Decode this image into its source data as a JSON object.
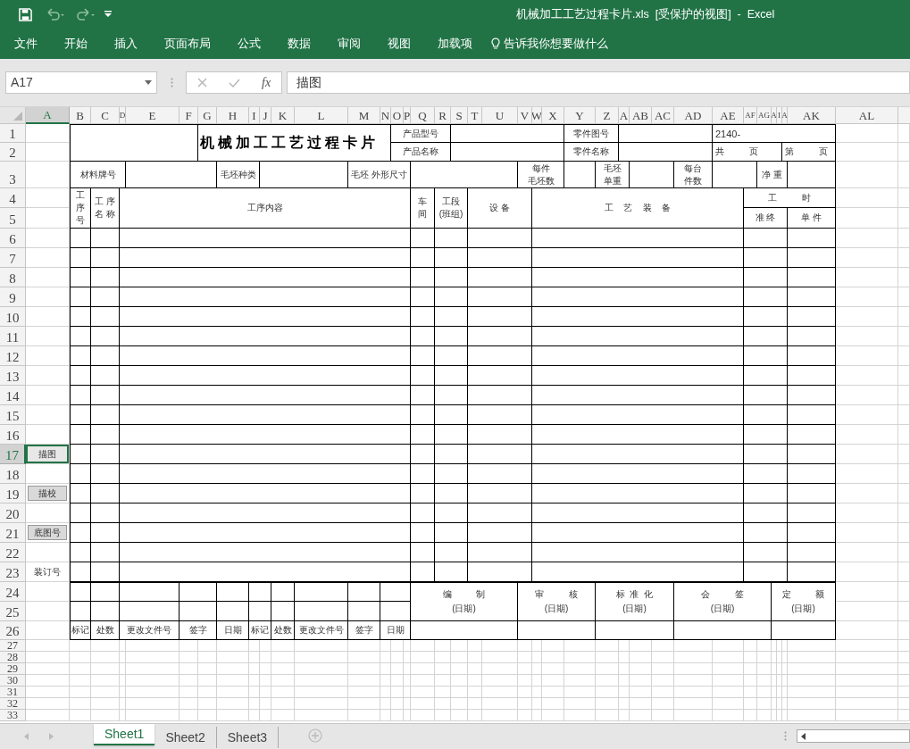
{
  "window": {
    "title": "机械加工工艺过程卡片.xls  [受保护的视图]  -  Excel"
  },
  "ribbon_tabs": [
    "文件",
    "开始",
    "插入",
    "页面布局",
    "公式",
    "数据",
    "审阅",
    "视图",
    "加载项"
  ],
  "tell_me": "告诉我你想要做什么",
  "name_box": "A17",
  "fx_label": "fx",
  "formula": "描图",
  "columns": [
    {
      "label": "A",
      "selected": true
    },
    {
      "label": "B",
      "selected": false
    },
    {
      "label": "C",
      "selected": false
    },
    {
      "label": "D",
      "selected": false
    },
    {
      "label": "E",
      "selected": false
    },
    {
      "label": "F",
      "selected": false
    },
    {
      "label": "G",
      "selected": false
    },
    {
      "label": "H",
      "selected": false
    },
    {
      "label": "I",
      "selected": false
    },
    {
      "label": "J",
      "selected": false
    },
    {
      "label": "K",
      "selected": false
    },
    {
      "label": "L",
      "selected": false
    },
    {
      "label": "M",
      "selected": false
    },
    {
      "label": "N",
      "selected": false
    },
    {
      "label": "O",
      "selected": false
    },
    {
      "label": "P",
      "selected": false
    },
    {
      "label": "Q",
      "selected": false
    },
    {
      "label": "R",
      "selected": false
    },
    {
      "label": "S",
      "selected": false
    },
    {
      "label": "T",
      "selected": false
    },
    {
      "label": "U",
      "selected": false
    },
    {
      "label": "V",
      "selected": false
    },
    {
      "label": "W",
      "selected": false
    },
    {
      "label": "X",
      "selected": false
    },
    {
      "label": "Y",
      "selected": false
    },
    {
      "label": "Z",
      "selected": false
    },
    {
      "label": "A",
      "selected": false
    },
    {
      "label": "AB",
      "selected": false
    },
    {
      "label": "AC",
      "selected": false
    },
    {
      "label": "AD",
      "selected": false
    },
    {
      "label": "AE",
      "selected": false
    },
    {
      "label": "AF",
      "selected": false
    },
    {
      "label": "AG",
      "selected": false
    },
    {
      "label": "A",
      "selected": false
    },
    {
      "label": "I",
      "selected": false
    },
    {
      "label": "A",
      "selected": false
    },
    {
      "label": "AK",
      "selected": false
    },
    {
      "label": "AL",
      "selected": false
    }
  ],
  "rows": [
    {
      "label": "1",
      "selected": false
    },
    {
      "label": "2",
      "selected": false
    },
    {
      "label": "3",
      "selected": false
    },
    {
      "label": "4",
      "selected": false
    },
    {
      "label": "5",
      "selected": false
    },
    {
      "label": "6",
      "selected": false
    },
    {
      "label": "7",
      "selected": false
    },
    {
      "label": "8",
      "selected": false
    },
    {
      "label": "9",
      "selected": false
    },
    {
      "label": "10",
      "selected": false
    },
    {
      "label": "11",
      "selected": false
    },
    {
      "label": "12",
      "selected": false
    },
    {
      "label": "13",
      "selected": false
    },
    {
      "label": "14",
      "selected": false
    },
    {
      "label": "15",
      "selected": false
    },
    {
      "label": "16",
      "selected": false
    },
    {
      "label": "17",
      "selected": true
    },
    {
      "label": "18",
      "selected": false
    },
    {
      "label": "19",
      "selected": false
    },
    {
      "label": "20",
      "selected": false
    },
    {
      "label": "21",
      "selected": false
    },
    {
      "label": "22",
      "selected": false
    },
    {
      "label": "23",
      "selected": false
    },
    {
      "label": "24",
      "selected": false
    },
    {
      "label": "25",
      "selected": false
    },
    {
      "label": "26",
      "selected": false
    },
    {
      "label": "27",
      "selected": false
    },
    {
      "label": "28",
      "selected": false
    },
    {
      "label": "29",
      "selected": false
    },
    {
      "label": "30",
      "selected": false
    },
    {
      "label": "31",
      "selected": false
    },
    {
      "label": "32",
      "selected": false
    },
    {
      "label": "33",
      "selected": false
    }
  ],
  "form_cells": [
    "机械加工工艺过程卡片",
    "产品型号",
    "零件图号",
    "2140-",
    "产品名称",
    "零件名称",
    "共          页",
    "第          页",
    "材料牌号",
    "毛坯种类",
    "毛坯 外形尺寸",
    "每件毛坯数",
    "毛坯单重",
    "每台件数",
    "净 重",
    "工序号",
    "工 序名 称",
    "工序内容",
    "车间",
    "工段(班组)",
    "设 备",
    "工    艺    装    备",
    "工          时",
    "准 终",
    "单 件",
    "编          制(日期)",
    "审          核(日期)",
    "标  准  化(日期)",
    "会          签(日期)",
    "定          额(日期)",
    "标记",
    "处数",
    "更改文件号",
    "签字",
    "日期",
    "标记",
    "处数",
    "更改文件号",
    "签字",
    "日期"
  ],
  "side_labels": [
    {
      "text": "描图",
      "shaded": true,
      "selected": true
    },
    {
      "text": "描校",
      "shaded": true,
      "selected": false
    },
    {
      "text": "底图号",
      "shaded": true,
      "selected": false
    },
    {
      "text": "装订号",
      "shaded": false,
      "selected": false
    }
  ],
  "sheet_tabs": [
    {
      "label": "Sheet1",
      "selected": true
    },
    {
      "label": "Sheet2",
      "selected": false
    },
    {
      "label": "Sheet3",
      "selected": false
    }
  ]
}
